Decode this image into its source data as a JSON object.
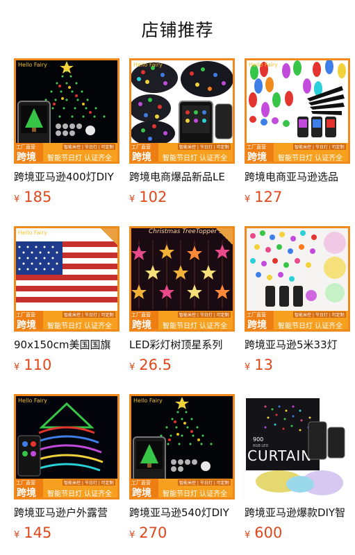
{
  "section": {
    "title": "店铺推荐"
  },
  "banner": {
    "cross_small": "工厂直营",
    "cross_big": "跨境",
    "feature_small": "智能米控 | 节日灯 | 可定制",
    "feature": "智能节日灯 认证齐全",
    "brand": "Hello Fairy"
  },
  "products": [
    {
      "title": "跨境亚马逊400灯DIY",
      "currency": "¥",
      "price": "185",
      "image": "tree-curtain-phone"
    },
    {
      "title": "跨境电商爆品新品LE",
      "currency": "¥",
      "price": "102",
      "image": "colorful-string-lights"
    },
    {
      "title": "跨境电商亚马逊选品",
      "currency": "¥",
      "price": "127",
      "image": "c9-bulb-lights"
    },
    {
      "title": "90x150cm美国国旗",
      "currency": "¥",
      "price": "110",
      "image": "usa-flag-lights"
    },
    {
      "title": "LED彩灯树顶星系列",
      "currency": "¥",
      "price": "26.5",
      "image": "star-curtain-lights",
      "overlay_text": "Christmas TreeTopper Star"
    },
    {
      "title": "跨境亚马逊5米33灯",
      "currency": "¥",
      "price": "13",
      "image": "fairy-string-lights"
    },
    {
      "title": "跨境亚马逊户外露营",
      "currency": "¥",
      "price": "145",
      "image": "outdoor-tree-lights"
    },
    {
      "title": "跨境亚马逊540灯DIY",
      "currency": "¥",
      "price": "270",
      "image": "tree-curtain-phone"
    },
    {
      "title": "跨境亚马逊爆款DIY智",
      "currency": "¥",
      "price": "600",
      "image": "curtain-box",
      "box_text": "CURTAIN",
      "box_count": "900",
      "box_sub": "RGB LED"
    }
  ]
}
